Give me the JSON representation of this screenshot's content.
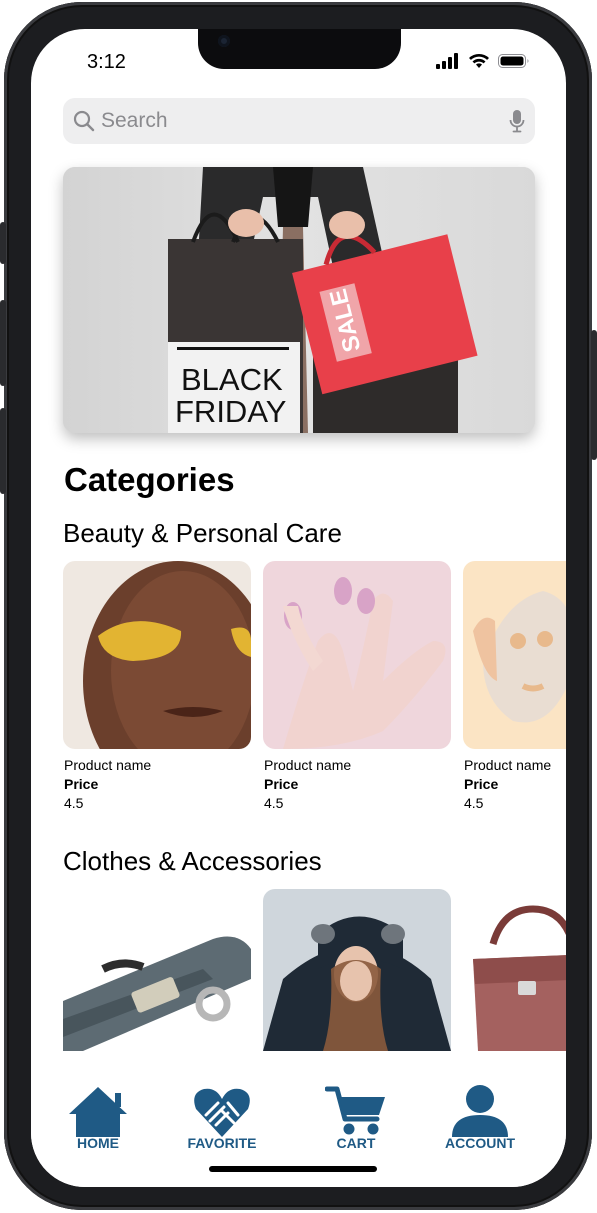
{
  "status_bar": {
    "time": "3:12"
  },
  "search": {
    "placeholder": "Search"
  },
  "banner": {
    "bag_text_line1": "BLACK",
    "bag_text_line2": "FRIDAY",
    "tag_text": "SALE"
  },
  "categories": {
    "title": "Categories",
    "sections": [
      {
        "title": "Beauty & Personal Care",
        "products": [
          {
            "name": "Product name",
            "price_label": "Price",
            "rating": "4.5",
            "image": "eye-patches-photo"
          },
          {
            "name": "Product name",
            "price_label": "Price",
            "rating": "4.5",
            "image": "pink-nails-photo"
          },
          {
            "name": "Product name",
            "price_label": "Price",
            "rating": "4.5",
            "image": "face-mask-photo"
          }
        ]
      },
      {
        "title": "Clothes & Accessories",
        "products": [
          {
            "image": "belt-photo"
          },
          {
            "image": "winter-jacket-photo"
          },
          {
            "image": "handbag-photo"
          }
        ]
      }
    ]
  },
  "tabbar": {
    "items": [
      {
        "label": "HOME",
        "icon": "home-icon"
      },
      {
        "label": "FAVORITE",
        "icon": "favorite-hands-heart-icon"
      },
      {
        "label": "CART",
        "icon": "cart-icon"
      },
      {
        "label": "ACCOUNT",
        "icon": "account-icon"
      }
    ]
  },
  "colors": {
    "tab_accent": "#1f5a85",
    "search_bg": "#eeeeef",
    "sale_red": "#e8404a"
  }
}
